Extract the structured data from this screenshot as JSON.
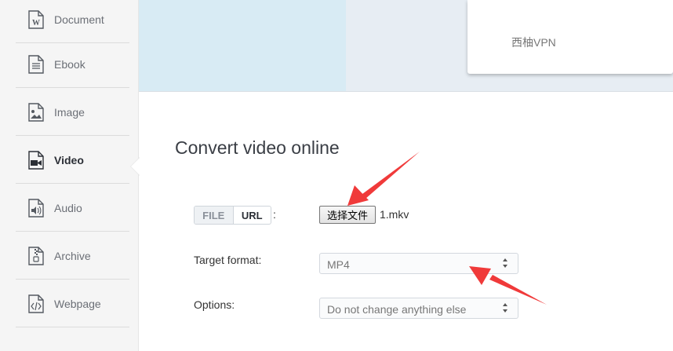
{
  "sidebar": {
    "items": [
      {
        "label": "Document",
        "icon": "document-icon"
      },
      {
        "label": "Ebook",
        "icon": "ebook-icon"
      },
      {
        "label": "Image",
        "icon": "image-icon"
      },
      {
        "label": "Video",
        "icon": "video-icon"
      },
      {
        "label": "Audio",
        "icon": "audio-icon"
      },
      {
        "label": "Archive",
        "icon": "archive-icon"
      },
      {
        "label": "Webpage",
        "icon": "webpage-icon"
      }
    ],
    "active": "Video"
  },
  "banner": {
    "vpn_text": "西柚VPN"
  },
  "main": {
    "title": "Convert video online",
    "source_toggle": {
      "file_label": "FILE",
      "url_label": "URL",
      "selected": "URL"
    },
    "colon": ":",
    "file_button_label": "选择文件",
    "file_name": "1.mkv",
    "target_format_label": "Target format:",
    "target_format_value": "MP4",
    "options_label": "Options:",
    "options_value": "Do not change anything else"
  },
  "colors": {
    "arrow": "#f03a3a",
    "banner_left": "#d8ebf4",
    "banner_right": "#e7edf3",
    "sidebar_bg": "#f5f5f5"
  }
}
